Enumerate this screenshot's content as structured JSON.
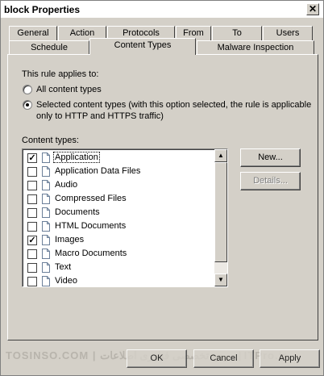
{
  "window": {
    "title": "block Properties",
    "close_glyph": "✕"
  },
  "tabs_row1": [
    "General",
    "Action",
    "Protocols",
    "From",
    "To",
    "Users"
  ],
  "tabs_row2": [
    "Schedule",
    "Content Types",
    "Malware Inspection"
  ],
  "active_tab": "Content Types",
  "rule": {
    "applies_label": "This rule applies to:",
    "option_all": "All content types",
    "option_selected_line1": "Selected content types (with this option selected, the rule is applicable",
    "option_selected_line2": "only to HTTP and HTTPS traffic)",
    "selected_option": "selected"
  },
  "content_types": {
    "label": "Content types:",
    "items": [
      {
        "label": "Application",
        "checked": true
      },
      {
        "label": "Application Data Files",
        "checked": false
      },
      {
        "label": "Audio",
        "checked": false
      },
      {
        "label": "Compressed Files",
        "checked": false
      },
      {
        "label": "Documents",
        "checked": false
      },
      {
        "label": "HTML Documents",
        "checked": false
      },
      {
        "label": "Images",
        "checked": true
      },
      {
        "label": "Macro Documents",
        "checked": false
      },
      {
        "label": "Text",
        "checked": false
      },
      {
        "label": "Video",
        "checked": false
      }
    ],
    "check_glyph": "✓"
  },
  "buttons": {
    "new": "New...",
    "details": "Details...",
    "ok": "OK",
    "cancel": "Cancel",
    "apply": "Apply"
  },
  "scrollbar": {
    "up_glyph": "▲",
    "down_glyph": "▼"
  },
  "watermark": "TOSINSO.COM | مرجع تخصصی فناوری اطلاعات | ITPro.ir",
  "colors": {
    "face": "#d4d0c8",
    "highlight": "#ffffff",
    "shadow": "#808080",
    "dark_shadow": "#404040"
  }
}
